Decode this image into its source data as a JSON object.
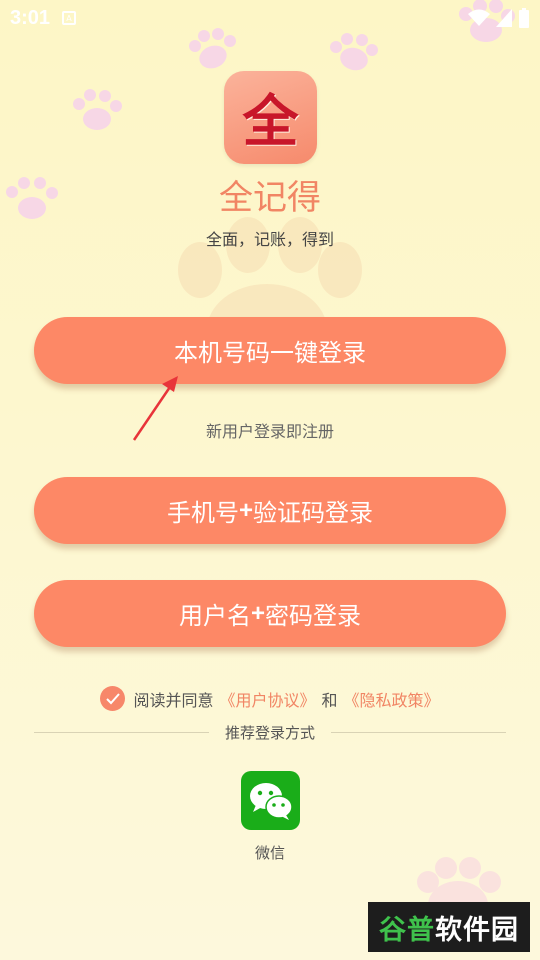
{
  "status_bar": {
    "time": "3:01"
  },
  "app": {
    "logo_char": "全",
    "name": "全记得",
    "slogan": "全面，记账，得到"
  },
  "buttons": {
    "one_click": "本机号码一键登录",
    "sms_prefix": "手机号",
    "sms_plus": "+",
    "sms_suffix": "验证码登录",
    "pwd_prefix": "用户名",
    "pwd_plus": "+",
    "pwd_suffix": "密码登录"
  },
  "hint": "新用户登录即注册",
  "agreement": {
    "prefix": "阅读并同意",
    "user_agreement": "《用户协议》",
    "and": "和",
    "privacy_policy": "《隐私政策》"
  },
  "other_login": {
    "title": "推荐登录方式",
    "wechat_label": "微信"
  },
  "watermark": {
    "part1": "谷普",
    "part2": "软件园"
  },
  "colors": {
    "primary": "#fd8866",
    "accent_text": "#f18564",
    "wechat": "#1aad19"
  },
  "icons": [
    "wifi-icon",
    "signal-icon",
    "battery-icon",
    "check-icon",
    "arrow-icon",
    "wechat-icon"
  ]
}
